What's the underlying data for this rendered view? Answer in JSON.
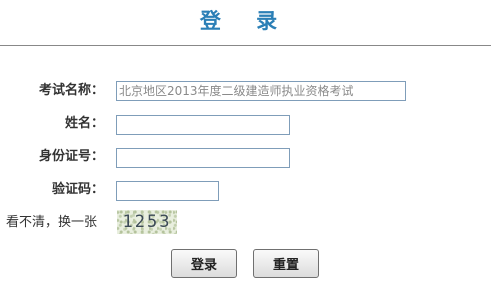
{
  "page": {
    "title": "登 录"
  },
  "form": {
    "exam_name": {
      "label": "考试名称：",
      "value": "北京地区2013年度二级建造师执业资格考试"
    },
    "name": {
      "label": "姓名：",
      "value": ""
    },
    "id_number": {
      "label": "身份证号：",
      "value": ""
    },
    "captcha": {
      "label": "验证码：",
      "value": "",
      "refresh_text": "看不清，换一张",
      "image_text": "1253"
    }
  },
  "buttons": {
    "login_label": "登录",
    "reset_label": "重置"
  }
}
